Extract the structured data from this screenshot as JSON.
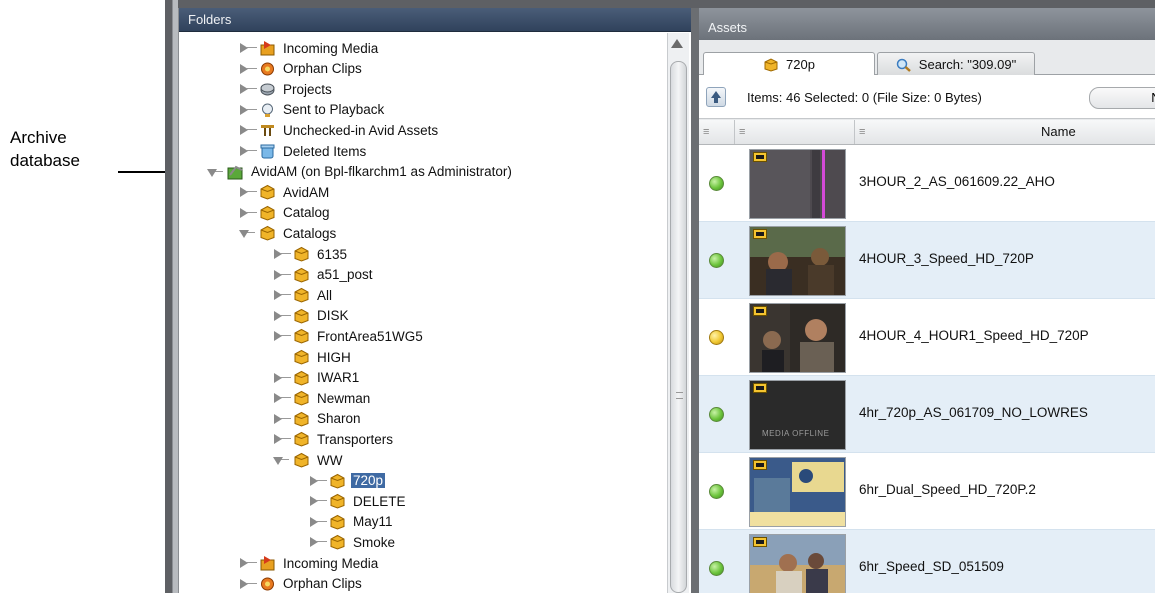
{
  "callout": {
    "text_line1": "Archive",
    "text_line2": "database"
  },
  "folders": {
    "title": "Folders",
    "tree": [
      {
        "label": "Incoming Media",
        "icon": "incoming-media-icon",
        "expander": "collapsed",
        "level": 1
      },
      {
        "label": "Orphan Clips",
        "icon": "orphan-clips-icon",
        "expander": "collapsed",
        "level": 1
      },
      {
        "label": "Projects",
        "icon": "projects-icon",
        "expander": "collapsed",
        "level": 1
      },
      {
        "label": "Sent to Playback",
        "icon": "sent-to-playback-icon",
        "expander": "collapsed",
        "level": 1
      },
      {
        "label": "Unchecked-in Avid Assets",
        "icon": "unchecked-assets-icon",
        "expander": "collapsed",
        "level": 1
      },
      {
        "label": "Deleted Items",
        "icon": "deleted-items-icon",
        "expander": "collapsed",
        "level": 1
      },
      {
        "label": "AvidAM (on Bpl-flkarchm1 as Administrator)",
        "icon": "archive-database-icon",
        "expander": "expanded",
        "level": 0
      },
      {
        "label": "AvidAM",
        "icon": "catalog-icon",
        "expander": "collapsed",
        "level": 1
      },
      {
        "label": "Catalog",
        "icon": "catalog-icon",
        "expander": "collapsed",
        "level": 1
      },
      {
        "label": "Catalogs",
        "icon": "catalog-icon",
        "expander": "expanded",
        "level": 1
      },
      {
        "label": "6135",
        "icon": "catalog-icon",
        "expander": "collapsed",
        "level": 2
      },
      {
        "label": "a51_post",
        "icon": "catalog-icon",
        "expander": "collapsed",
        "level": 2
      },
      {
        "label": "All",
        "icon": "catalog-icon",
        "expander": "collapsed",
        "level": 2
      },
      {
        "label": "DISK",
        "icon": "catalog-icon",
        "expander": "collapsed",
        "level": 2
      },
      {
        "label": "FrontArea51WG5",
        "icon": "catalog-icon",
        "expander": "collapsed",
        "level": 2
      },
      {
        "label": "HIGH",
        "icon": "catalog-icon",
        "expander": "none",
        "level": 2
      },
      {
        "label": "IWAR1",
        "icon": "catalog-icon",
        "expander": "collapsed",
        "level": 2
      },
      {
        "label": "Newman",
        "icon": "catalog-icon",
        "expander": "collapsed",
        "level": 2
      },
      {
        "label": "Sharon",
        "icon": "catalog-icon",
        "expander": "collapsed",
        "level": 2
      },
      {
        "label": "Transporters",
        "icon": "catalog-icon",
        "expander": "collapsed",
        "level": 2
      },
      {
        "label": "WW",
        "icon": "catalog-icon",
        "expander": "expanded",
        "level": 2
      },
      {
        "label": "720p",
        "icon": "catalog-icon",
        "expander": "collapsed",
        "level": 3,
        "selected": true
      },
      {
        "label": "DELETE",
        "icon": "catalog-icon",
        "expander": "collapsed",
        "level": 3
      },
      {
        "label": "May11",
        "icon": "catalog-icon",
        "expander": "collapsed",
        "level": 3
      },
      {
        "label": "Smoke",
        "icon": "catalog-icon",
        "expander": "collapsed",
        "level": 3
      },
      {
        "label": "Incoming Media",
        "icon": "incoming-media-icon",
        "expander": "collapsed",
        "level": 1
      },
      {
        "label": "Orphan Clips",
        "icon": "orphan-clips-icon",
        "expander": "collapsed",
        "level": 1
      }
    ]
  },
  "assets": {
    "title": "Assets",
    "tabs": [
      {
        "label": "720p",
        "icon": "catalog-icon"
      },
      {
        "label": "Search: \"309.09\"",
        "icon": "search-icon"
      }
    ],
    "items_text": "Items: 46 Selected: 0 (File Size: 0 Bytes)",
    "cut_button_label": "N",
    "columns": {
      "menu_glyph": "≡",
      "name": "Name"
    },
    "rows": [
      {
        "name": "3HOUR_2_AS_061609.22_AHO",
        "status": "green",
        "thumb": "purple-line"
      },
      {
        "name": "4HOUR_3_Speed_HD_720P",
        "status": "green",
        "thumb": "crowd"
      },
      {
        "name": "4HOUR_4_HOUR1_Speed_HD_720P",
        "status": "yellow",
        "thumb": "man"
      },
      {
        "name": "4hr_720p_AS_061709_NO_LOWRES",
        "status": "green",
        "thumb": "offline",
        "thumb_text": "MEDIA OFFLINE"
      },
      {
        "name": "6hr_Dual_Speed_HD_720P.2",
        "status": "green",
        "thumb": "sign"
      },
      {
        "name": "6hr_Speed_SD_051509",
        "status": "green",
        "thumb": "outdoor"
      }
    ]
  },
  "colors": {
    "panel_header": "#3b4e69",
    "selection": "#3f6aa3",
    "row_alt": "#e4eef7",
    "status_green": "#6cc43c",
    "status_yellow": "#f0c832"
  }
}
